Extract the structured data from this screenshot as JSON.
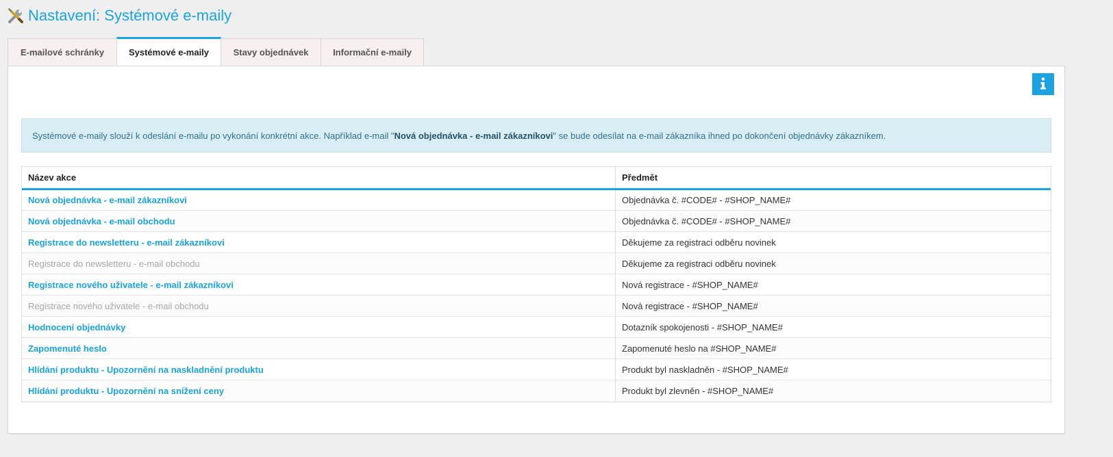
{
  "header": {
    "title": "Nastavení: Systémové e-maily",
    "icon": "tools-icon"
  },
  "tabs": [
    {
      "label": "E-mailové schránky",
      "active": false
    },
    {
      "label": "Systémové e-maily",
      "active": true
    },
    {
      "label": "Stavy objednávek",
      "active": false
    },
    {
      "label": "Informační e-maily",
      "active": false
    }
  ],
  "info_button": {
    "icon": "info-icon",
    "color": "#1aa3e0"
  },
  "alert": {
    "text_before": "Systémové e-maily slouží k odeslání e-mailu po vykonání konkrétní akce. Například e-mail \"",
    "text_bold": "Nová objednávka - e-mail zákazníkovi",
    "text_after": "\" se bude odesílat na e-mail zákazníka ihned po dokončení objednávky zákazníkem."
  },
  "table": {
    "columns": [
      "Název akce",
      "Předmět"
    ],
    "rows": [
      {
        "name": "Nová objednávka - e-mail zákazníkovi",
        "subject": "Objednávka č. #CODE# - #SHOP_NAME#",
        "active": true
      },
      {
        "name": "Nová objednávka - e-mail obchodu",
        "subject": "Objednávka č. #CODE# - #SHOP_NAME#",
        "active": true
      },
      {
        "name": "Registrace do newsletteru - e-mail zákazníkovi",
        "subject": "Děkujeme za registraci odběru novinek",
        "active": true
      },
      {
        "name": "Registrace do newsletteru - e-mail obchodu",
        "subject": "Děkujeme za registraci odběru novinek",
        "active": false
      },
      {
        "name": "Registrace nového uživatele - e-mail zákazníkovi",
        "subject": "Nová registrace - #SHOP_NAME#",
        "active": true
      },
      {
        "name": "Registrace nového uživatele - e-mail obchodu",
        "subject": "Nová registrace - #SHOP_NAME#",
        "active": false
      },
      {
        "name": "Hodnocení objednávky",
        "subject": "Dotazník spokojenosti - #SHOP_NAME#",
        "active": true
      },
      {
        "name": "Zapomenuté heslo",
        "subject": "Zapomenuté heslo na #SHOP_NAME#",
        "active": true
      },
      {
        "name": "Hlídání produktu - Upozornění na naskladnění produktu",
        "subject": "Produkt byl naskladněn - #SHOP_NAME#",
        "active": true
      },
      {
        "name": "Hlídání produktu - Upozornění na snížení ceny",
        "subject": "Produkt byl zlevněn - #SHOP_NAME#",
        "active": true
      }
    ]
  },
  "colors": {
    "accent": "#1aa3e0",
    "disabled_link": "#a6a6a6",
    "alert_bg": "#d9edf5"
  }
}
